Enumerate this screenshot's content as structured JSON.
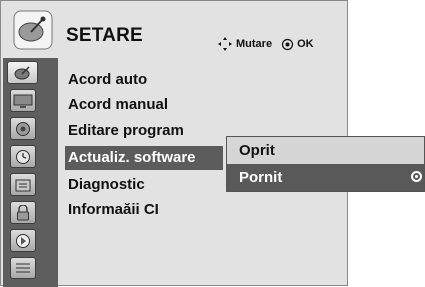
{
  "header": {
    "title": "SETARE",
    "hint_move": "Mutare",
    "hint_ok": "OK"
  },
  "sidebar": {
    "items": [
      {
        "icon": "satellite-dish-icon",
        "active": true
      },
      {
        "icon": "tv-screen-icon",
        "active": false
      },
      {
        "icon": "speaker-icon",
        "active": false
      },
      {
        "icon": "clock-icon",
        "active": false
      },
      {
        "icon": "option-box-icon",
        "active": false
      },
      {
        "icon": "lock-icon",
        "active": false
      },
      {
        "icon": "input-source-icon",
        "active": false
      },
      {
        "icon": "usb-icon",
        "active": false
      }
    ]
  },
  "menu": {
    "items": [
      {
        "label": "Acord auto",
        "selected": false
      },
      {
        "label": "Acord manual",
        "selected": false
      },
      {
        "label": "Editare program",
        "selected": false
      },
      {
        "label": "Actualiz. software",
        "selected": true
      },
      {
        "label": "Diagnostic",
        "selected": false
      },
      {
        "label": "Informaăii CI",
        "selected": false
      }
    ]
  },
  "submenu": {
    "items": [
      {
        "label": "Oprit",
        "selected": false
      },
      {
        "label": "Pornit",
        "selected": true
      }
    ]
  },
  "colors": {
    "background": "#e2e2e2",
    "sidebar": "#5e5e5e",
    "selection": "#5c5c5c",
    "text": "#111111"
  }
}
